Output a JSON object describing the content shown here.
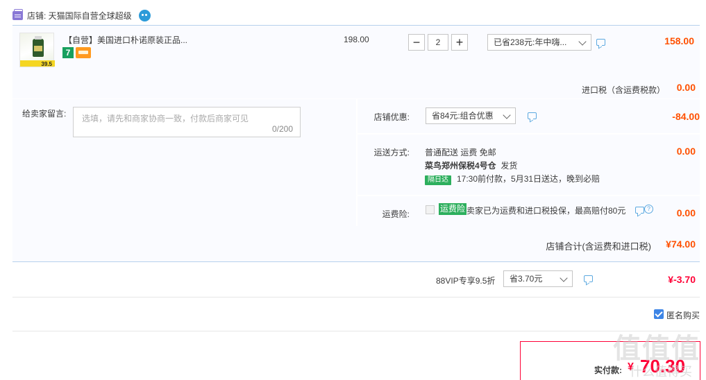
{
  "shop": {
    "label": "店铺: 天猫国际自营全球超级"
  },
  "item": {
    "title": "【自营】美国进口朴诺原装正品...",
    "badge_seven": "7",
    "thumb_price": "39.5",
    "unit_price": "198.00",
    "quantity": "2",
    "minus": "−",
    "plus": "+",
    "promo": "已省238元:年中嗨...",
    "price": "158.00",
    "tax_label": "进口税（含运费税款）",
    "tax_value": "0.00"
  },
  "memo": {
    "label": "给卖家留言:",
    "placeholder": "选填，请先和商家协商一致，付款后商家可见",
    "count": "0/200"
  },
  "shop_discount": {
    "label": "店铺优惠:",
    "value": "省84元:组合优惠",
    "amount": "-84.00"
  },
  "shipping": {
    "label": "运送方式:",
    "method": "普通配送 运费 免邮",
    "warehouse": "菜鸟郑州保税4号仓",
    "dispatch": "发货",
    "tag": "隔日达",
    "promise": "17:30前付款，5月31日送达，晚到必赔",
    "amount": "0.00"
  },
  "insurance": {
    "label": "运费险:",
    "tag": "运费险",
    "text": "卖家已为运费和进口税投保，最高赔付80元",
    "help": "?",
    "amount": "0.00"
  },
  "subtotal": {
    "label": "店铺合计(含运费和进口税)",
    "value": "¥74.00"
  },
  "vip": {
    "label": "88VIP专享9.5折",
    "option": "省3.70元",
    "amount": "¥-3.70"
  },
  "anonymous": {
    "label": "匿名购买"
  },
  "payment": {
    "label": "实付款:",
    "symbol": "¥",
    "value": "70.30"
  },
  "watermark": {
    "text": "值值值",
    "site": "什么值得买"
  },
  "colors": {
    "accent": "#ff5000",
    "total": "#ff0036",
    "border": "#b7d0ec",
    "green": "#2daf5d"
  }
}
